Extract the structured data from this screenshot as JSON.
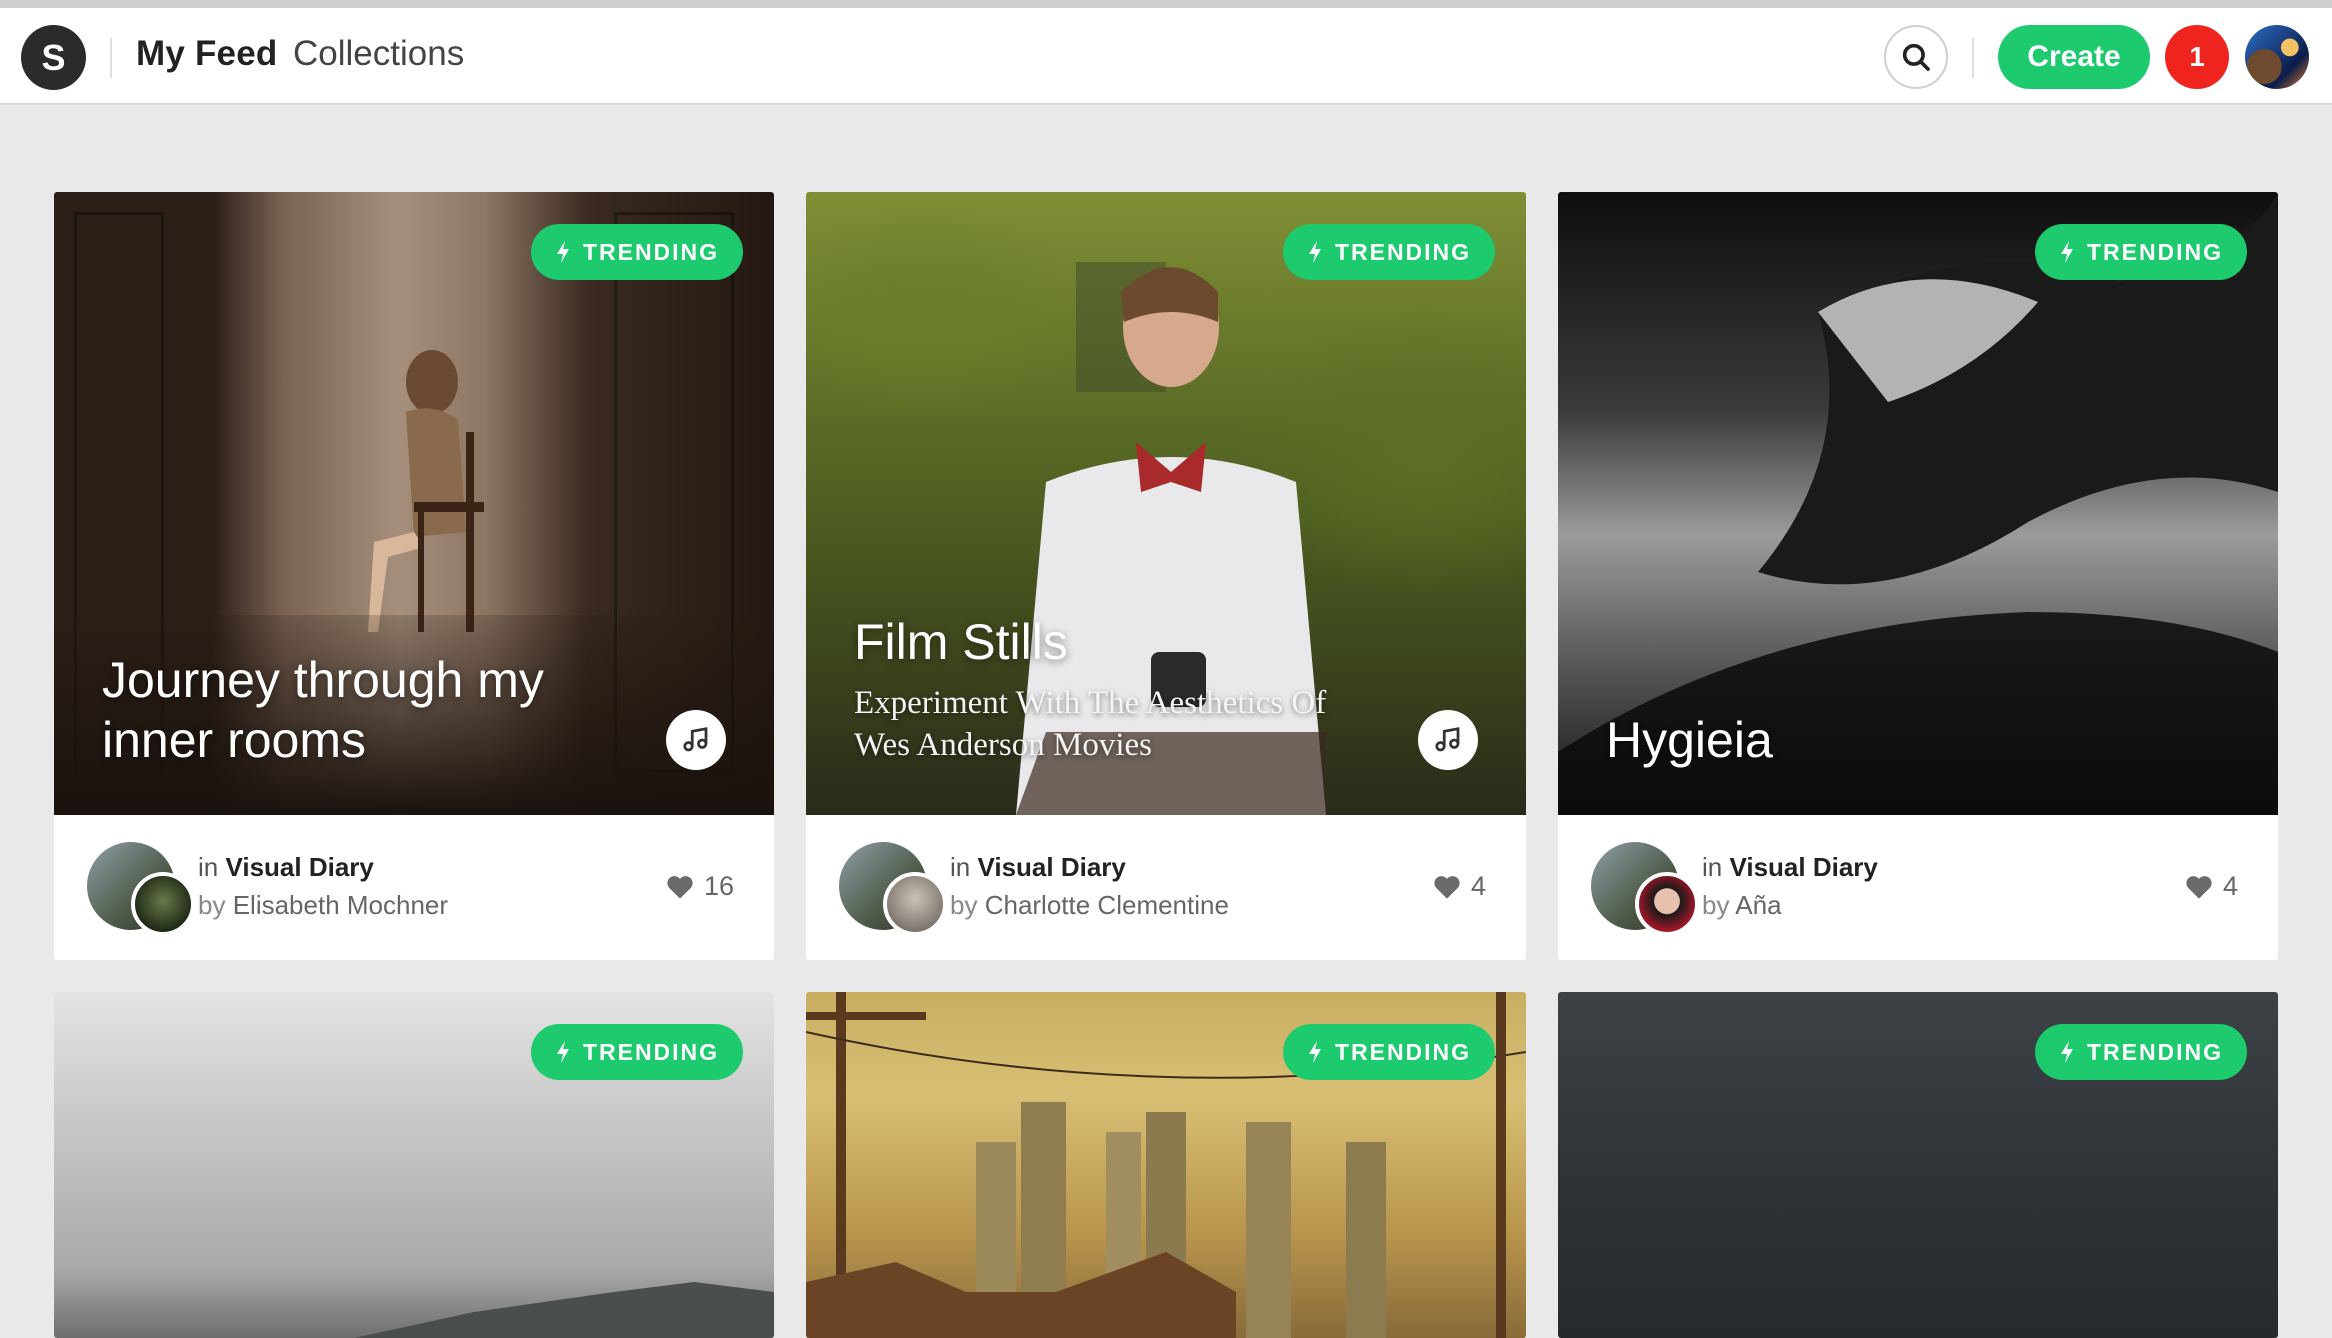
{
  "header": {
    "logo_letter": "S",
    "nav": {
      "feed": "My Feed",
      "collections": "Collections"
    },
    "create_label": "Create",
    "notifications_count": "1"
  },
  "colors": {
    "accent_green": "#1dca6e",
    "notification_red": "#f0241e",
    "page_background": "#e9e9e9"
  },
  "cards": [
    {
      "badge": "TRENDING",
      "title_lines": [
        "Journey through my",
        "inner rooms"
      ],
      "subtitle_lines": [],
      "has_audio": true,
      "in_prefix": "in",
      "collection": "Visual Diary",
      "by_prefix": "by",
      "author": "Elisabeth Mochner",
      "likes": "16"
    },
    {
      "badge": "TRENDING",
      "title_lines": [
        "Film Stills"
      ],
      "subtitle_lines": [
        "Experiment With The Aesthetics Of",
        "Wes Anderson Movies"
      ],
      "has_audio": true,
      "in_prefix": "in",
      "collection": "Visual Diary",
      "by_prefix": "by",
      "author": "Charlotte Clementine",
      "likes": "4"
    },
    {
      "badge": "TRENDING",
      "title_lines": [
        "Hygieia"
      ],
      "subtitle_lines": [],
      "has_audio": false,
      "in_prefix": "in",
      "collection": "Visual Diary",
      "by_prefix": "by",
      "author": "Aña",
      "likes": "4"
    },
    {
      "badge": "TRENDING"
    },
    {
      "badge": "TRENDING"
    },
    {
      "badge": "TRENDING"
    }
  ],
  "icons": {
    "search": "search-icon",
    "bolt": "lightning-bolt-icon",
    "music": "music-note-icon",
    "heart": "heart-icon"
  }
}
